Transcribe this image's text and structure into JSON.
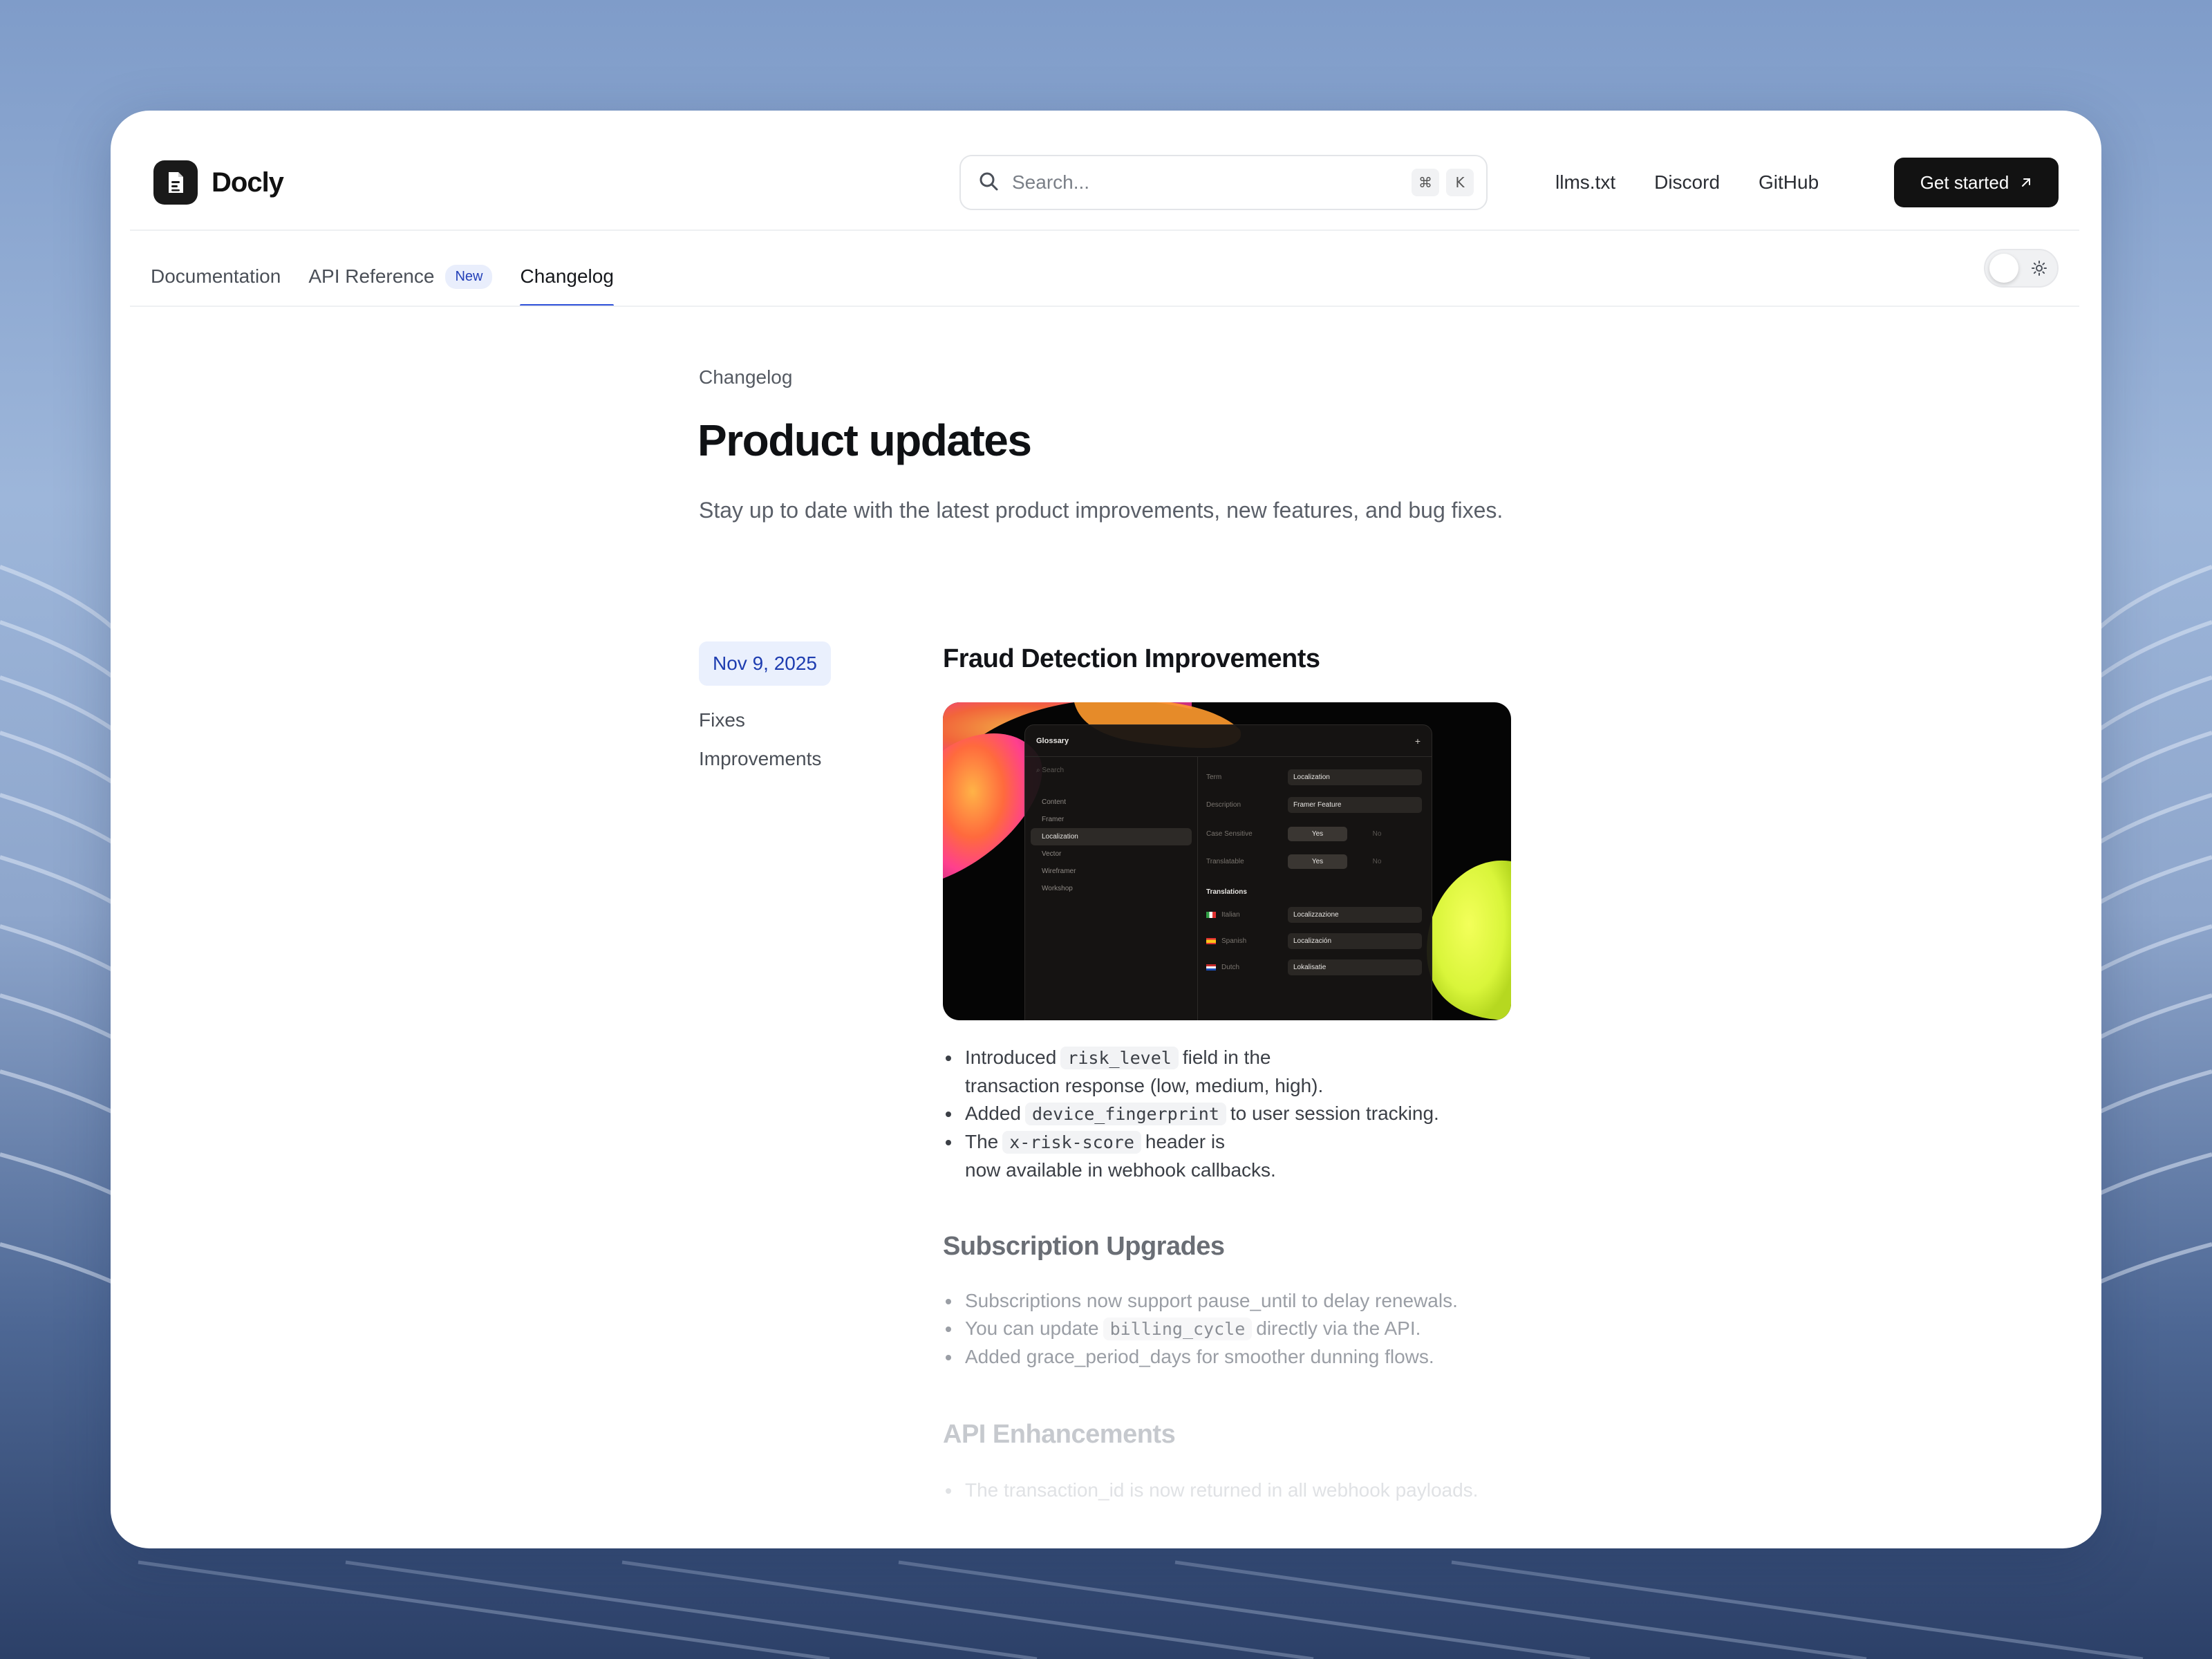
{
  "brand": {
    "name": "Docly"
  },
  "search": {
    "placeholder": "Search...",
    "shortcut_mod": "⌘",
    "shortcut_key": "K"
  },
  "nav": {
    "links": [
      "llms.txt",
      "Discord",
      "GitHub"
    ],
    "cta_label": "Get started"
  },
  "tabs": [
    {
      "label": "Documentation",
      "active": false
    },
    {
      "label": "API Reference",
      "badge": "New",
      "active": false
    },
    {
      "label": "Changelog",
      "active": true
    }
  ],
  "page": {
    "breadcrumb": "Changelog",
    "title": "Product updates",
    "subtitle": "Stay up to date with the latest product improvements, new features, and bug fixes."
  },
  "release": {
    "date": "Nov 9, 2025",
    "tags": [
      "Fixes",
      "Improvements"
    ]
  },
  "entries": [
    {
      "title": "Fraud Detection Improvements",
      "bullets": [
        {
          "pre": "Introduced",
          "code": "risk_level",
          "post": "field in the",
          "line2": "transaction response (low, medium, high)."
        },
        {
          "pre": "Added",
          "code": "device_fingerprint",
          "post": "to user session tracking."
        },
        {
          "pre": "The",
          "code": "x-risk-score",
          "post": "header is",
          "line2": "now available in webhook callbacks."
        }
      ]
    },
    {
      "title": "Subscription Upgrades",
      "bullets": [
        {
          "text": "Subscriptions now support pause_until to delay renewals."
        },
        {
          "pre": "You can update",
          "code": "billing_cycle",
          "post": "directly via the API."
        },
        {
          "text": "Added grace_period_days for smoother dunning flows."
        }
      ]
    },
    {
      "title": "API Enhancements",
      "bullets": [
        {
          "text": "The transaction_id is now returned in all webhook payloads."
        }
      ]
    }
  ],
  "screenshot": {
    "panel_title": "Glossary",
    "search_placeholder": "Search",
    "list": [
      "Content",
      "Framer",
      "Localization",
      "Vector",
      "Wireframer",
      "Workshop"
    ],
    "selected": "Localization",
    "fields": [
      {
        "label": "Term",
        "value": "Localization"
      },
      {
        "label": "Description",
        "value": "Framer Feature"
      }
    ],
    "toggles": [
      {
        "label": "Case Sensitive",
        "on": "Yes",
        "off": "No"
      },
      {
        "label": "Translatable",
        "on": "Yes",
        "off": "No"
      }
    ],
    "translations_header": "Translations",
    "translations": [
      {
        "lang": "Italian",
        "value": "Localizzazione"
      },
      {
        "lang": "Spanish",
        "value": "Localización"
      },
      {
        "lang": "Dutch",
        "value": "Lokalisatie"
      }
    ]
  },
  "colors": {
    "accent": "#2d4fd8",
    "date_bg": "#eaf0fd",
    "date_fg": "#1e3db0",
    "cta_bg": "#121212"
  },
  "icons": {
    "search": "search-icon",
    "cta": "arrow-up-right-icon",
    "theme": "sun-icon",
    "logo": "document-icon"
  }
}
